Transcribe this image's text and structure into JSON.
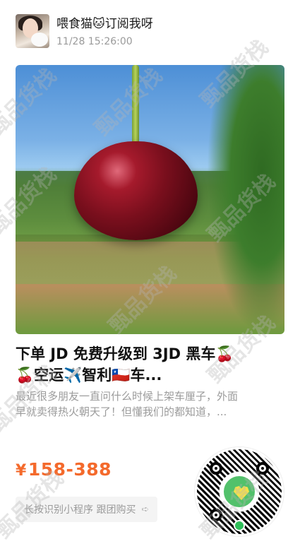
{
  "post": {
    "author_name": "喂食猫🐱订阅我呀",
    "timestamp": "11/28 15:26:00",
    "title_line1": "下单 JD 免费升级到 3JD 黑车🍒",
    "title_line2": "🍒空运✈️智利🇨🇱车...",
    "desc_line1": "最近很多朋友一直问什么时候上架车厘子，外面",
    "desc_line2": "早就卖得热火朝天了！但懂我们的都知道，...",
    "price_currency": "¥",
    "price_range": "158-388",
    "scan_label": "长按识别小程序 跟团购买",
    "scan_arrow": "➪"
  },
  "watermark": "甄品货栈",
  "colors": {
    "price": "#f46a2c",
    "qr_logo": "#52c16b"
  }
}
